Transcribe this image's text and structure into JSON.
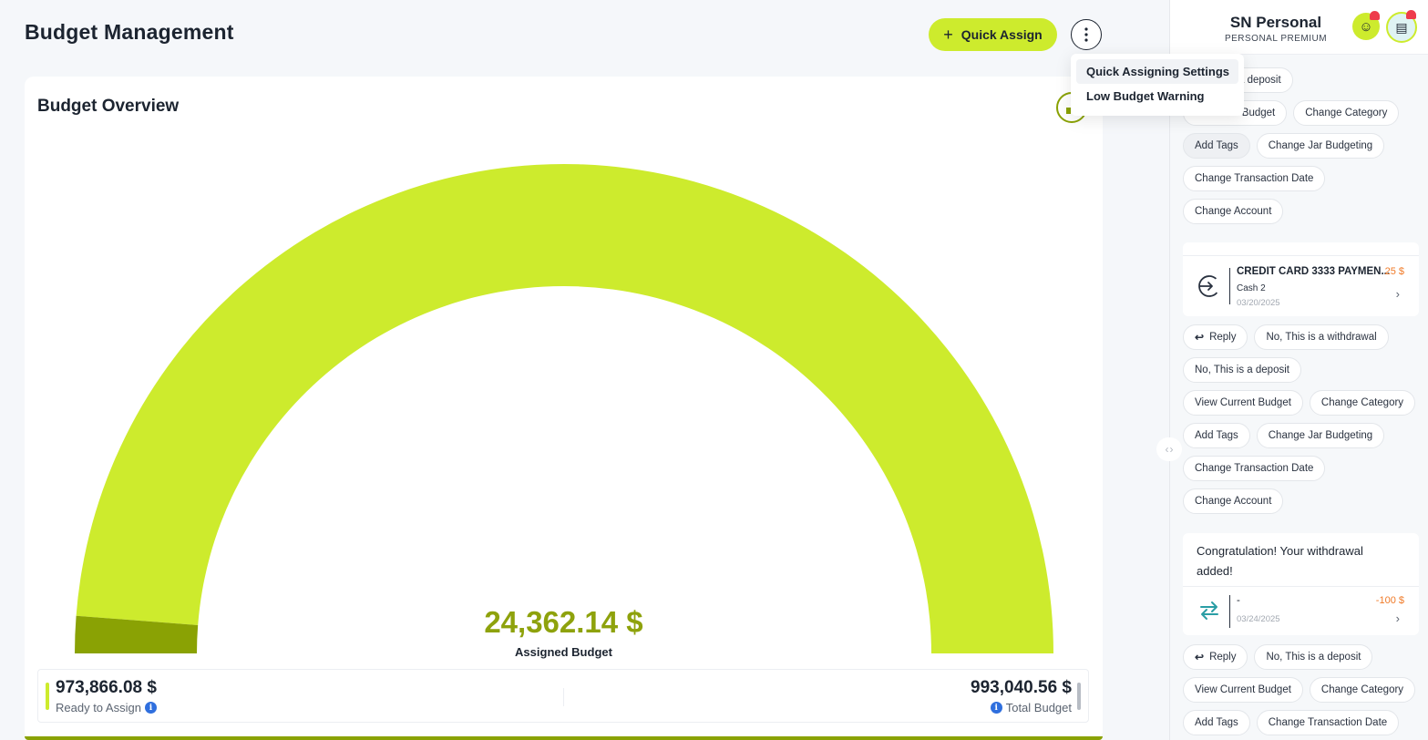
{
  "header": {
    "title": "Budget Management",
    "quick_assign_label": "Quick Assign"
  },
  "menu": {
    "items": [
      {
        "label": "Quick Assigning Settings"
      },
      {
        "label": "Low Budget Warning"
      }
    ]
  },
  "overview": {
    "title": "Budget Overview",
    "assigned_value": "24,362.14 $",
    "assigned_label": "Assigned Budget",
    "assigned_fraction": 0.0245,
    "ready_value": "973,866.08 $",
    "ready_label": "Ready to Assign",
    "total_value": "993,040.56 $",
    "total_label": "Total Budget",
    "colors": {
      "remaining": "#cdeb2d",
      "assigned": "#8aa204"
    }
  },
  "panel": {
    "account_name": "SN Personal",
    "account_sub": "PERSONAL  PREMIUM",
    "top_chips_row1": [
      {
        "label": "a deposit"
      }
    ],
    "top_chips_row2": [
      {
        "label": "nt Budget"
      },
      {
        "label": "Change Category"
      }
    ],
    "top_chips_rest": [
      {
        "label": "Add Tags"
      },
      {
        "label": "Change Jar Budgeting"
      },
      {
        "label": "Change Transaction Date"
      },
      {
        "label": "Change Account"
      }
    ],
    "txn1": {
      "title": "CREDIT CARD 3333 PAYMEN...",
      "account": "Cash 2",
      "date": "03/20/2025",
      "amount": "25 $"
    },
    "chips_mid": [
      {
        "label": "Reply",
        "icon": "reply-icon"
      },
      {
        "label": "No, This is a withdrawal"
      },
      {
        "label": "No, This is a deposit"
      },
      {
        "label": "View Current Budget"
      },
      {
        "label": "Change Category"
      },
      {
        "label": "Add Tags"
      },
      {
        "label": "Change Jar Budgeting"
      },
      {
        "label": "Change Transaction Date"
      },
      {
        "label": "Change Account"
      }
    ],
    "message": "Congratulation! Your withdrawal added!",
    "txn2": {
      "title": "-",
      "date": "03/24/2025",
      "amount": "-100 $"
    },
    "chips_bottom": [
      {
        "label": "Reply",
        "icon": "reply-icon"
      },
      {
        "label": "No, This is a deposit"
      },
      {
        "label": "View Current Budget"
      },
      {
        "label": "Change Category"
      },
      {
        "label": "Add Tags"
      },
      {
        "label": "Change Transaction Date"
      }
    ]
  }
}
